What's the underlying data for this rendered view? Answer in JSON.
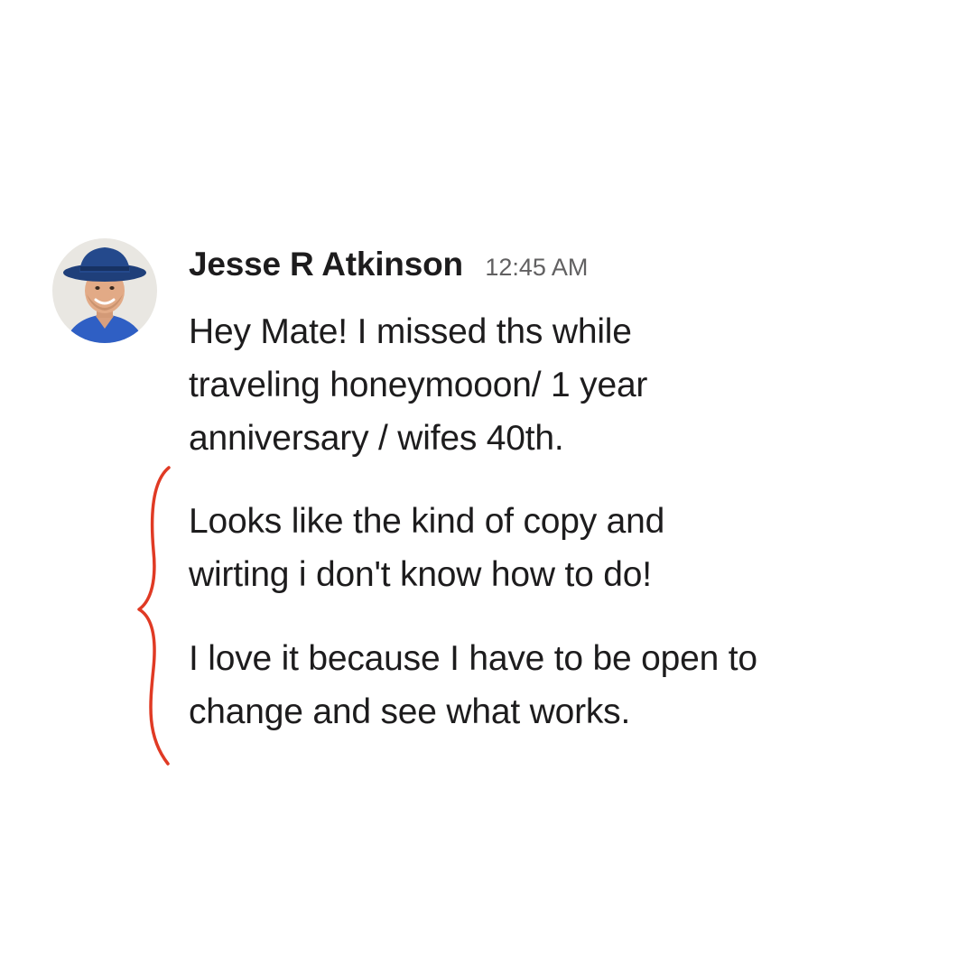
{
  "message": {
    "sender": "Jesse R Atkinson",
    "timestamp": "12:45 AM",
    "paragraphs": [
      "Hey Mate! I missed ths while\ntraveling honeymooon/ 1 year\nanniversary / wifes 40th.",
      "Looks like the kind of copy and\nwirting i don't know how to do!",
      "I love it because I have to be open to\nchange and see what works."
    ]
  },
  "annotation": {
    "type": "curly-brace",
    "color": "#e03a24"
  },
  "avatar": {
    "icon": "profile-photo-man-blue-hat"
  }
}
